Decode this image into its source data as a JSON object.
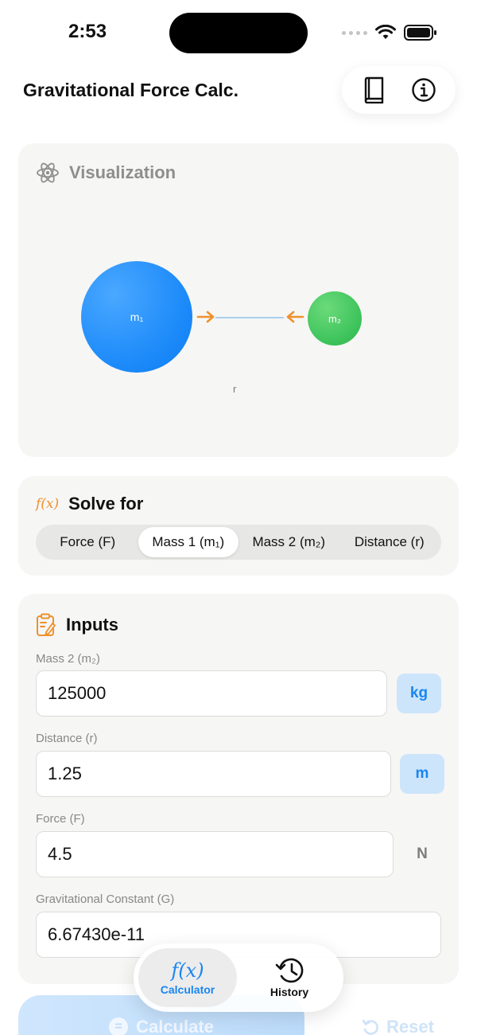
{
  "status": {
    "time": "2:53"
  },
  "header": {
    "title": "Gravitational Force Calc.",
    "actions": [
      "book-icon",
      "info-icon"
    ]
  },
  "visualization": {
    "title": "Visualization",
    "mass1_label": "m₁",
    "mass2_label": "m₂",
    "distance_label": "r",
    "colors": {
      "mass1": "#1f8cfa",
      "mass2": "#3cc25a",
      "arrow": "#f0902c"
    }
  },
  "solve_for": {
    "icon_text": "f(x)",
    "title": "Solve for",
    "options": [
      "Force (F)",
      "Mass 1 (m₁)",
      "Mass 2 (m₂)",
      "Distance (r)"
    ],
    "selected": "Mass 1 (m₁)"
  },
  "inputs": {
    "title": "Inputs",
    "fields": [
      {
        "label": "Mass 2 (m₂)",
        "value": "125000",
        "unit": "kg"
      },
      {
        "label": "Distance (r)",
        "value": "1.25",
        "unit": "m"
      },
      {
        "label": "Force (F)",
        "value": "4.5",
        "unit": "N"
      },
      {
        "label": "Gravitational Constant (G)",
        "value": "6.67430e-11"
      }
    ]
  },
  "actions": {
    "calculate": "Calculate",
    "reset": "Reset"
  },
  "tabs": {
    "calculator_icon": "f(x)",
    "calculator": "Calculator",
    "history": "History"
  },
  "accent": "#1a86f0"
}
